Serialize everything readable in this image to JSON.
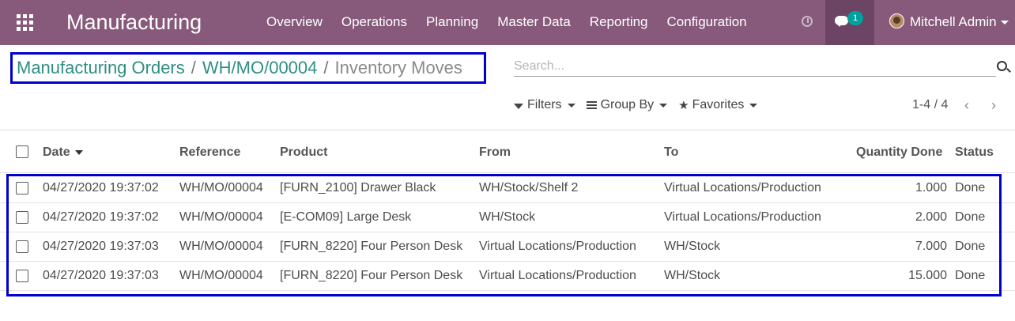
{
  "navbar": {
    "app_title": "Manufacturing",
    "menu": [
      "Overview",
      "Operations",
      "Planning",
      "Master Data",
      "Reporting",
      "Configuration"
    ],
    "chat_badge": "1",
    "user_name": "Mitchell Admin",
    "bg_color": "#875a7b"
  },
  "breadcrumb": {
    "root": "Manufacturing Orders",
    "parent": "WH/MO/00004",
    "current": "Inventory Moves",
    "sep": "/"
  },
  "search": {
    "placeholder": "Search..."
  },
  "filters": {
    "filters_label": "Filters",
    "group_by_label": "Group By",
    "favorites_label": "Favorites"
  },
  "pager": {
    "value": "1-4 / 4"
  },
  "table": {
    "columns": {
      "date": "Date",
      "reference": "Reference",
      "product": "Product",
      "from": "From",
      "to": "To",
      "qty": "Quantity Done",
      "status": "Status"
    },
    "rows": [
      {
        "date": "04/27/2020 19:37:02",
        "reference": "WH/MO/00004",
        "product": "[FURN_2100] Drawer Black",
        "from": "WH/Stock/Shelf 2",
        "to": "Virtual Locations/Production",
        "qty": "1.000",
        "status": "Done"
      },
      {
        "date": "04/27/2020 19:37:02",
        "reference": "WH/MO/00004",
        "product": "[E-COM09] Large Desk",
        "from": "WH/Stock",
        "to": "Virtual Locations/Production",
        "qty": "2.000",
        "status": "Done"
      },
      {
        "date": "04/27/2020 19:37:03",
        "reference": "WH/MO/00004",
        "product": "[FURN_8220] Four Person Desk",
        "from": "Virtual Locations/Production",
        "to": "WH/Stock",
        "qty": "7.000",
        "status": "Done"
      },
      {
        "date": "04/27/2020 19:37:03",
        "reference": "WH/MO/00004",
        "product": "[FURN_8220] Four Person Desk",
        "from": "Virtual Locations/Production",
        "to": "WH/Stock",
        "qty": "15.000",
        "status": "Done"
      }
    ]
  }
}
